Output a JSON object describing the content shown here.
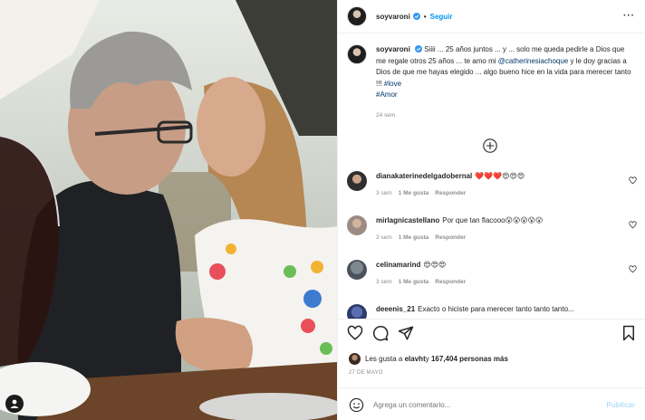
{
  "header": {
    "username": "soyvaroni",
    "separator": "•",
    "follow_label": "Seguir",
    "more_label": "···"
  },
  "caption": {
    "username": "soyvaroni",
    "text_1": "Siiii ... 25 años juntos ... y ... solo me queda pedirle a Dios que me regale otros 25 años ... te amo mi ",
    "mention": "@catherinesiachoque",
    "text_2": " y le doy gracias a Dios de que me hayas elegido ... algo bueno hice en la vida para merecer tanto !!! ",
    "hashtag_1": "#love",
    "hashtag_2": "#Amor",
    "time": "24 sem"
  },
  "comments": [
    {
      "username": "dianakaterinedelgadobernal",
      "text": "❤️❤️❤️😍😍😍",
      "time": "3 sem",
      "likes": "1 Me gusta",
      "reply": "Responder"
    },
    {
      "username": "mirlagnicastellano",
      "text": "Por que tan flacooo😮😮😮😮😮",
      "time": "3 sem",
      "likes": "1 Me gusta",
      "reply": "Responder"
    },
    {
      "username": "celinamarind",
      "text": "😍😍😍",
      "time": "3 sem",
      "likes": "1 Me gusta",
      "reply": "Responder"
    },
    {
      "username": "deeenis_21",
      "text": "Exacto o hiciste para merecer tanto tanto tanto...",
      "time": "",
      "likes": "",
      "reply": ""
    }
  ],
  "likes": {
    "prefix": "Les gusta a ",
    "username": "elavht",
    "middle": " y ",
    "count": "167,404 personas más"
  },
  "date": "27 DE MAYO",
  "add_comment": {
    "placeholder": "Agrega un comentario...",
    "publish_label": "Publicar"
  },
  "colors": {
    "accent": "#0095f6",
    "publish_disabled": "#b2dffc",
    "muted": "#8e8e8e",
    "text": "#262626"
  },
  "icons": [
    "more-icon",
    "verified-icon",
    "load-more-plus-icon",
    "heart-icon",
    "comment-icon",
    "share-icon",
    "bookmark-icon",
    "emoji-icon",
    "tag-user-icon"
  ]
}
